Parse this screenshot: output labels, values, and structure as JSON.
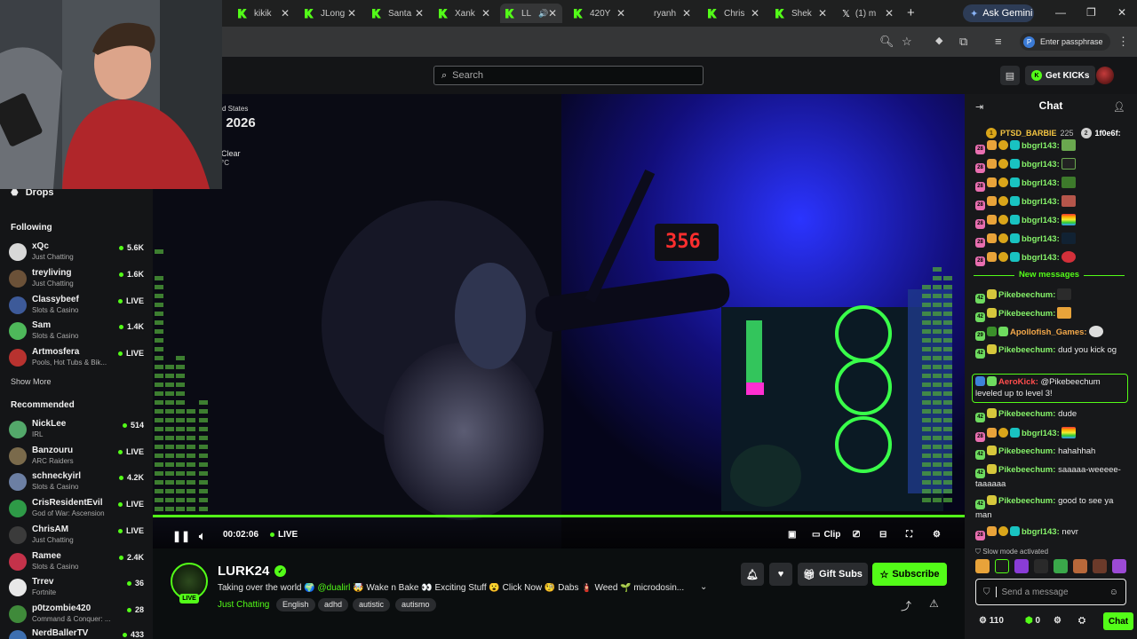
{
  "browser": {
    "tabs": [
      {
        "label": "kikik"
      },
      {
        "label": "JLong"
      },
      {
        "label": "Santa"
      },
      {
        "label": "Xank"
      },
      {
        "label": "LL"
      },
      {
        "label": "420Y"
      },
      {
        "label": "ryanh"
      },
      {
        "label": "Chris"
      },
      {
        "label": "Shek"
      },
      {
        "label": "(1) m"
      }
    ],
    "ask_gemini": "Ask Gemini",
    "passphrase": "Enter passphrase",
    "new_tab_symbol": "+"
  },
  "kick": {
    "search_placeholder": "Search",
    "get_kicks": "Get KICKs"
  },
  "overlay": {
    "states_text": "d States",
    "date_text": ", 2026",
    "weather": "Clear",
    "temp_unit": "°C"
  },
  "sidebar": {
    "drops": "Drops",
    "following_label": "Following",
    "following": [
      {
        "name": "xQc",
        "category": "Just Chatting",
        "count": "5.6K"
      },
      {
        "name": "treyliving",
        "category": "Just Chatting",
        "count": "1.6K"
      },
      {
        "name": "Classybeef",
        "category": "Slots & Casino",
        "count": "LIVE"
      },
      {
        "name": "Sam",
        "category": "Slots & Casino",
        "count": "1.4K"
      },
      {
        "name": "Artmosfera",
        "category": "Pools, Hot Tubs & Bik...",
        "count": "LIVE"
      }
    ],
    "show_more": "Show More",
    "recommended_label": "Recommended",
    "recommended": [
      {
        "name": "NickLee",
        "category": "IRL",
        "count": "514"
      },
      {
        "name": "Banzouru",
        "category": "ARC Raiders",
        "count": "LIVE"
      },
      {
        "name": "schneckyirl",
        "category": "Slots & Casino",
        "count": "4.2K"
      },
      {
        "name": "CrisResidentEvil",
        "category": "God of War: Ascension",
        "count": "LIVE"
      },
      {
        "name": "ChrisAM",
        "category": "Just Chatting",
        "count": "LIVE"
      },
      {
        "name": "Ramee",
        "category": "Slots & Casino",
        "count": "2.4K"
      },
      {
        "name": "Trrev",
        "category": "Fortnite",
        "count": "36"
      },
      {
        "name": "p0tzombie420",
        "category": "Command & Conquer: ...",
        "count": "28"
      },
      {
        "name": "NerdBallerTV",
        "category": "",
        "count": "433"
      }
    ]
  },
  "player": {
    "time": "00:02:06",
    "live": "LIVE",
    "clip": "Clip",
    "display_value": "356"
  },
  "stream": {
    "name": "LURK24",
    "title_pre": "Taking over the world 🌍 ",
    "mention": "@dualirl",
    "title_post": " 🤯 Wake n Bake 👀 Exciting Stuff 😮 Click Now 🧐 Dabs 🧯 Weed 🌱 microdosin...",
    "live_badge": "LIVE",
    "category": "Just Chatting",
    "tags": [
      "English",
      "adhd",
      "autistic",
      "autismo"
    ],
    "gift_subs": "Gift Subs",
    "subscribe": "Subscribe"
  },
  "chat": {
    "title": "Chat",
    "pinned": [
      {
        "name": "PTSD_BARBIE",
        "value": "225"
      },
      {
        "name": "1f0e6f:",
        "value": ""
      }
    ],
    "new_messages": "New messages",
    "messages": [
      {
        "user": "bbgrl143:",
        "text": ""
      },
      {
        "user": "bbgrl143:",
        "text": ""
      },
      {
        "user": "bbgrl143:",
        "text": ""
      },
      {
        "user": "bbgrl143:",
        "text": ""
      },
      {
        "user": "bbgrl143:",
        "text": ""
      },
      {
        "user": "bbgrl143:",
        "text": ""
      },
      {
        "user": "bbgrl143:",
        "text": ""
      },
      {
        "user": "Pikebeechum:",
        "text": ""
      },
      {
        "user": "Pikebeechum:",
        "text": ""
      },
      {
        "user": "Apollofish_Games:",
        "text": ""
      },
      {
        "user": "Pikebeechum:",
        "text": "dud you kick og"
      },
      {
        "user": "AeroKick:",
        "text": "@Pikebeechum leveled up to level 3!"
      },
      {
        "user": "Pikebeechum:",
        "text": "dude"
      },
      {
        "user": "bbgrl143:",
        "text": ""
      },
      {
        "user": "Pikebeechum:",
        "text": "hahahhah"
      },
      {
        "user": "Pikebeechum:",
        "text": "saaaaa-weeeee-taaaaaa"
      },
      {
        "user": "Pikebeechum:",
        "text": "good to see ya man"
      },
      {
        "user": "bbgrl143:",
        "text": "nevr"
      }
    ],
    "slow_mode": "Slow mode activated",
    "input_placeholder": "Send a message",
    "kicks_count": "110",
    "points": "0",
    "chat_button": "Chat"
  }
}
